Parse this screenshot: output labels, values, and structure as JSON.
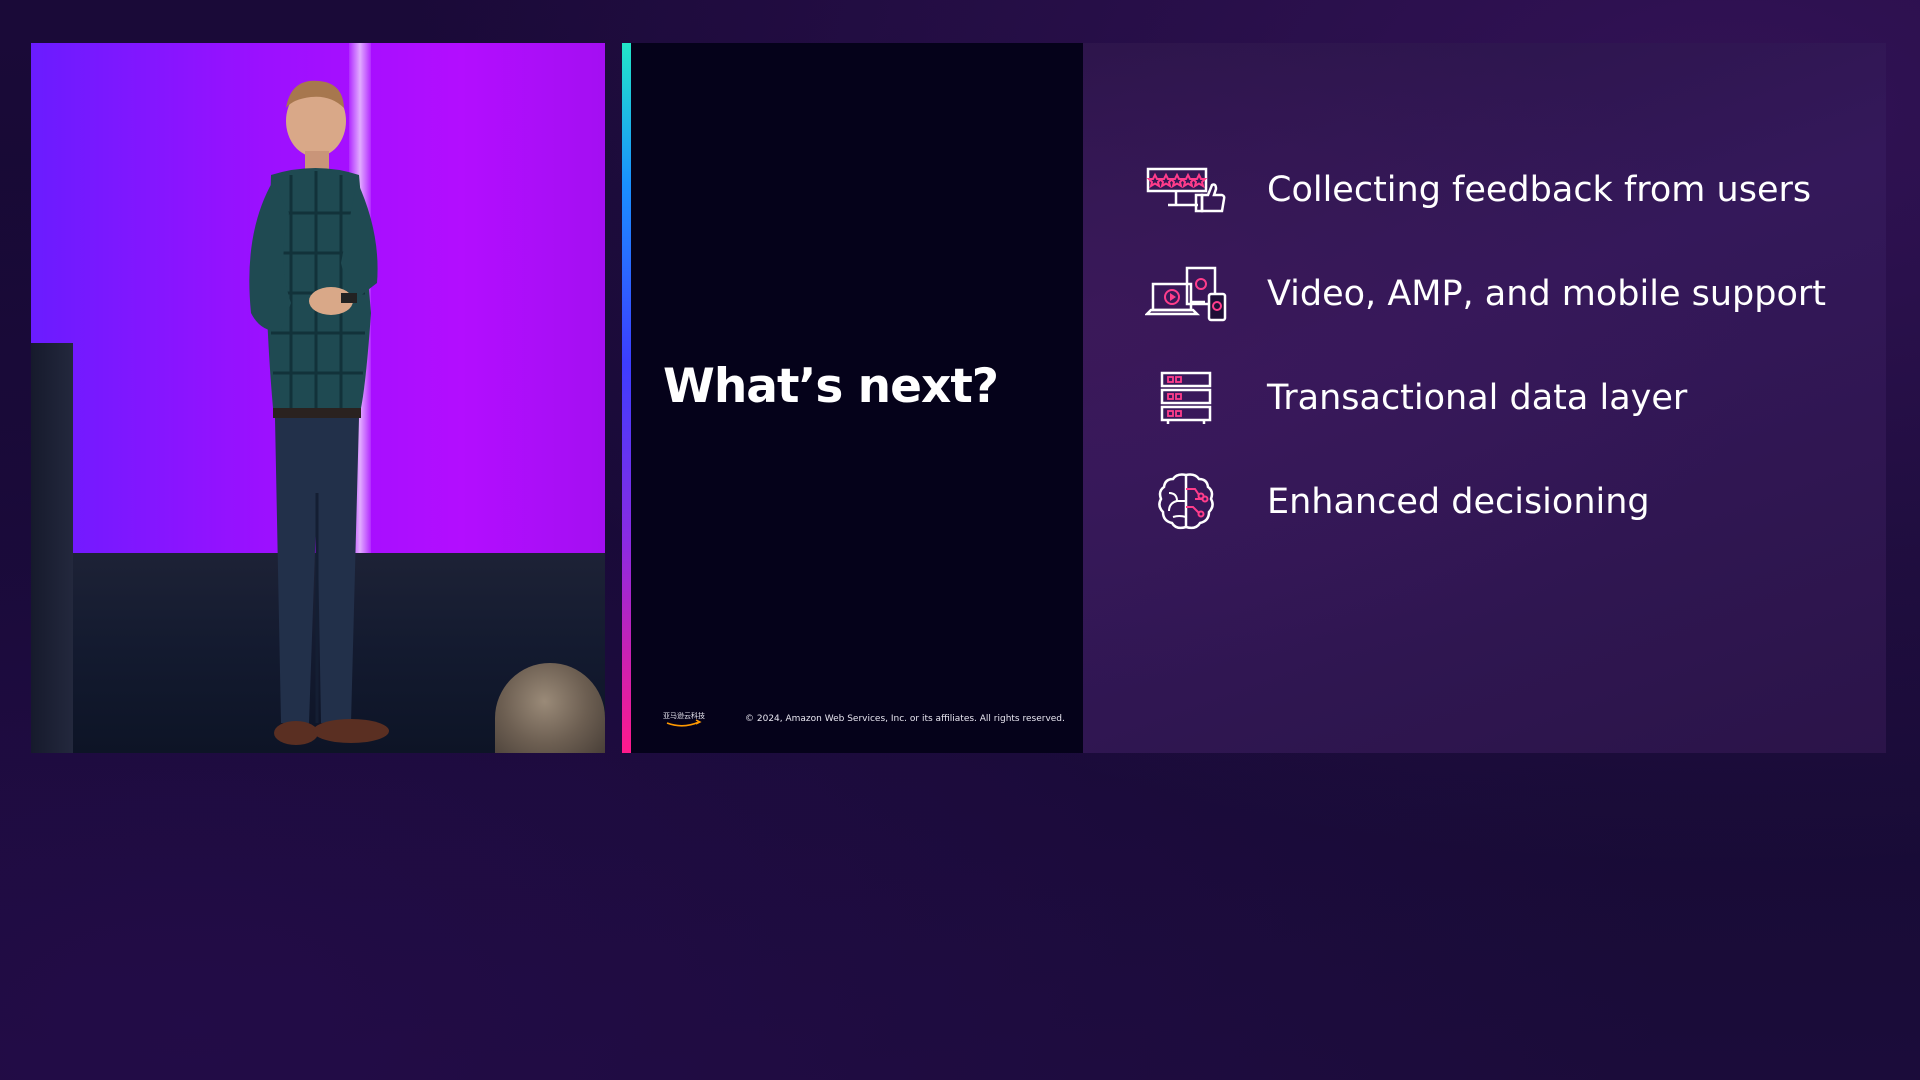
{
  "slide": {
    "title": "What’s next?",
    "items": [
      {
        "label": "Collecting feedback from users",
        "icon": "feedback-rating-thumbs-up-icon"
      },
      {
        "label": "Video, AMP, and mobile support",
        "icon": "multi-device-video-icon"
      },
      {
        "label": "Transactional data layer",
        "icon": "server-stack-icon"
      },
      {
        "label": "Enhanced decisioning",
        "icon": "brain-circuit-icon"
      }
    ],
    "footer": {
      "logo_text": "亚马逊云科技",
      "copyright": "© 2024, Amazon Web Services, Inc. or its affiliates. All rights reserved."
    }
  },
  "colors": {
    "icon_outline": "#ffffff",
    "icon_accent": "#ff3d8b",
    "accent_bar_top": "#22e6c8",
    "accent_bar_bottom": "#ff1a8c",
    "stage_backdrop": "#a40ef2"
  }
}
